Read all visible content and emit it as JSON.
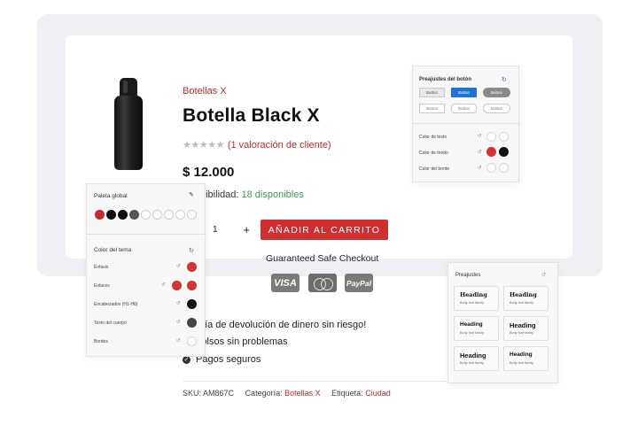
{
  "product": {
    "category": "Botellas X",
    "title": "Botella Black X",
    "rating_stars": "★★★★★",
    "rating_text": "(1 valoración de cliente)",
    "price": "$ 12.000",
    "availability_label": "nibilidad:",
    "availability_value": "18 disponibles",
    "quantity": "1",
    "quantity_plus": "+",
    "add_to_cart": "AÑADIR AL CARRITO"
  },
  "checkout": {
    "title": "Guaranteed Safe Checkout",
    "payments": [
      "VISA",
      "MasterCard",
      "PayPal"
    ]
  },
  "guarantees": [
    {
      "text": "arantía de devolución de dinero sin riesgo!"
    },
    {
      "text": "embolsos sin problemas"
    },
    {
      "text": "Pagos seguros"
    }
  ],
  "meta": {
    "sku_label": "SKU:",
    "sku": "AM867C",
    "category_label": "Categoría:",
    "category": "Botellas X",
    "tag_label": "Etiqueta:",
    "tag": "Ciudad"
  },
  "button_presets": {
    "title": "Preajustes del botón",
    "buttons_row1": [
      "Button",
      "Button",
      "Button"
    ],
    "buttons_row2": [
      "Button",
      "Button",
      "Button"
    ],
    "rows": [
      "Color de texto",
      "Color de fondo",
      "Color del borde"
    ]
  },
  "global_palette": {
    "title": "Paleta global",
    "swatches": [
      "#c62a2a",
      "#111111",
      "#111111",
      "#555555",
      "#ffffff",
      "#ffffff",
      "#ffffff",
      "#ffffff",
      "#ffffff"
    ],
    "theme_title": "Color del tema",
    "rows": [
      "Énfasis",
      "Enlaces",
      "Encabezados (H1-H6)",
      "Texto del cuerpo",
      "Bordes"
    ]
  },
  "typography_presets": {
    "title": "Preajustes",
    "cards": [
      {
        "heading": "Heading",
        "body": "Body font family"
      },
      {
        "heading": "Heading",
        "body": "Body font family"
      },
      {
        "heading": "Heading",
        "body": "Body font family"
      },
      {
        "heading": "Heading",
        "body": "Body font family"
      },
      {
        "heading": "Heading",
        "body": "Body font family"
      },
      {
        "heading": "Heading",
        "body": "Body font family"
      }
    ]
  },
  "colors": {
    "accent": "#c62a2a",
    "stock_green": "#3c9a4f",
    "button_blue": "#1f74d1"
  }
}
